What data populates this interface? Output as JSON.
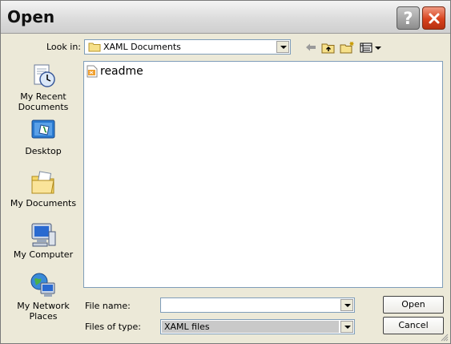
{
  "window": {
    "title": "Open"
  },
  "titlebar": {
    "help_icon": "help-icon",
    "close_icon": "close-icon"
  },
  "lookin": {
    "label": "Look in:",
    "value": "XAML Documents"
  },
  "toolbar": [
    "back-arrow-icon",
    "up-folder-icon",
    "new-folder-icon",
    "view-menu-icon"
  ],
  "places": [
    {
      "label1": "My Recent",
      "label2": "Documents",
      "icon": "recent-documents-icon"
    },
    {
      "label1": "Desktop",
      "label2": "",
      "icon": "desktop-icon"
    },
    {
      "label1": "My Documents",
      "label2": "",
      "icon": "my-documents-icon"
    },
    {
      "label1": "My Computer",
      "label2": "",
      "icon": "my-computer-icon"
    },
    {
      "label1": "My Network",
      "label2": "Places",
      "icon": "my-network-places-icon"
    }
  ],
  "files": [
    {
      "name": "readme",
      "icon": "xaml-file-icon"
    }
  ],
  "filename": {
    "label": "File name:",
    "value": ""
  },
  "filetype": {
    "label": "Files of type:",
    "value": "XAML files"
  },
  "buttons": {
    "open": "Open",
    "cancel": "Cancel"
  }
}
